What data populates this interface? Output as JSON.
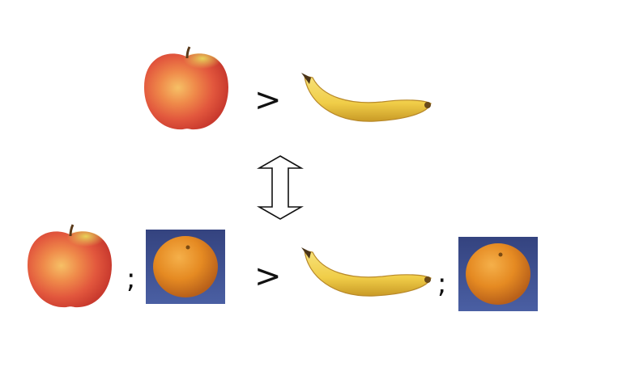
{
  "symbols": {
    "greater_than": ">",
    "separator": ";"
  },
  "colors": {
    "background": "#ffffff",
    "orange_backdrop": "#3b4b8c",
    "arrow_stroke": "#111111"
  },
  "icons": {
    "top_left": "apple-icon",
    "top_right": "banana-icon",
    "bottom_left_1": "apple-icon",
    "bottom_left_2": "orange-icon",
    "bottom_right_1": "banana-icon",
    "bottom_right_2": "orange-icon",
    "middle": "double-headed-arrow-icon"
  }
}
